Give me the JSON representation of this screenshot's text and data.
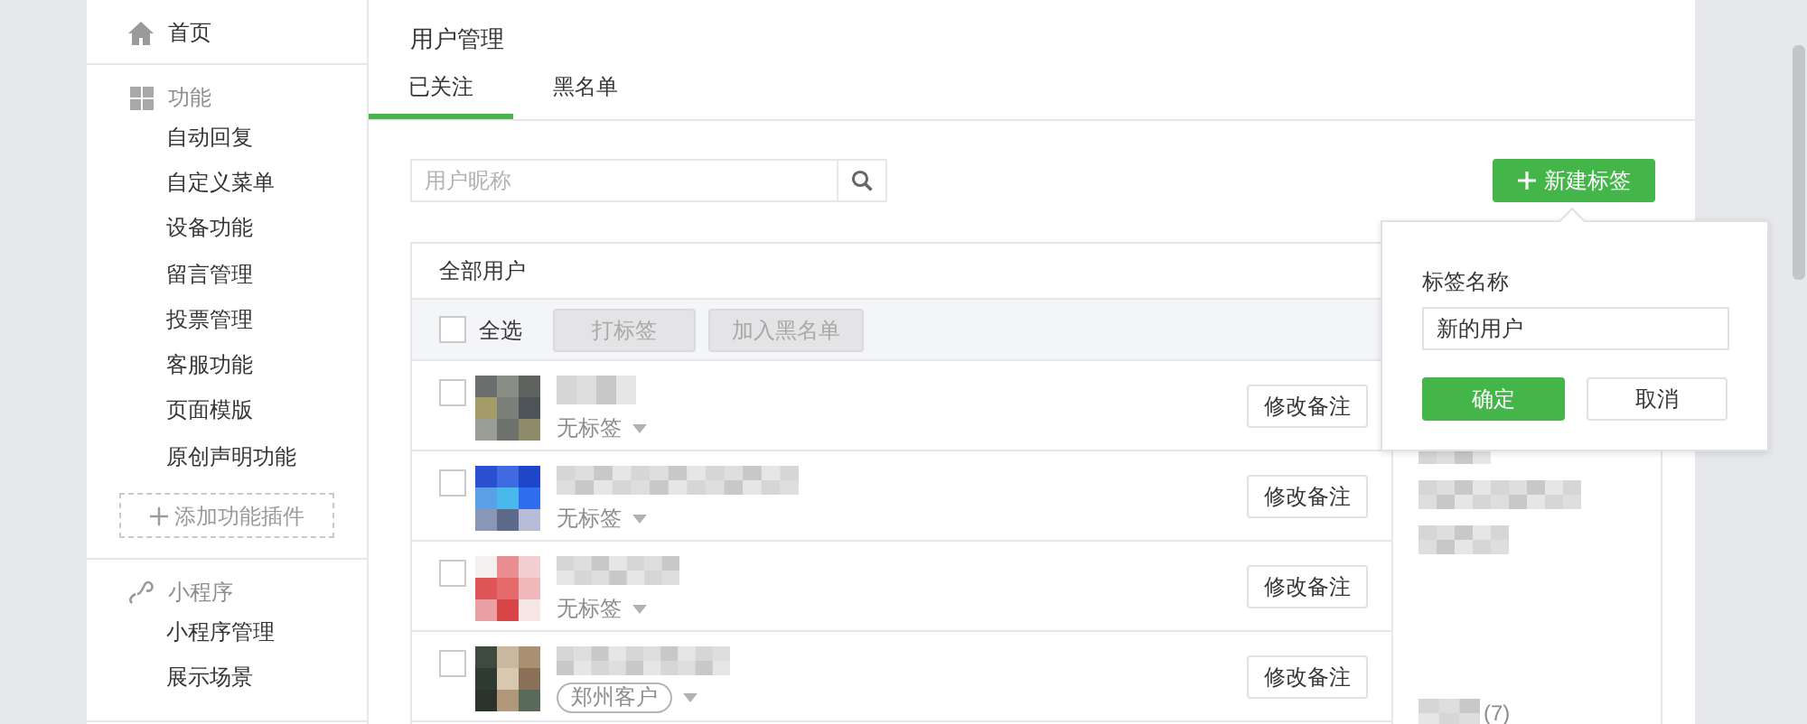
{
  "sidebar": {
    "items": [
      {
        "label": "首页"
      },
      {
        "label": "功能",
        "children": [
          {
            "label": "自动回复"
          },
          {
            "label": "自定义菜单"
          },
          {
            "label": "设备功能"
          },
          {
            "label": "留言管理"
          },
          {
            "label": "投票管理"
          },
          {
            "label": "客服功能"
          },
          {
            "label": "页面模版"
          },
          {
            "label": "原创声明功能"
          }
        ],
        "add_button": "添加功能插件"
      },
      {
        "label": "小程序",
        "children": [
          {
            "label": "小程序管理"
          },
          {
            "label": "展示场景"
          }
        ]
      }
    ]
  },
  "page_title": "用户管理",
  "tabs": [
    {
      "label": "已关注",
      "selected": true
    },
    {
      "label": "黑名单",
      "selected": false
    }
  ],
  "search": {
    "placeholder": "用户昵称"
  },
  "new_tag_button": "新建标签",
  "table": {
    "title": "全部用户",
    "select_all": {
      "label": "全选",
      "checked": false
    },
    "actions": [
      "打标签",
      "加入黑名单"
    ],
    "rows": [
      {
        "checked": false,
        "kind": "plain",
        "tag": "无标签",
        "remark_button": "修改备注"
      },
      {
        "checked": false,
        "kind": "plain",
        "tag": "无标签",
        "remark_button": "修改备注"
      },
      {
        "checked": false,
        "kind": "plain",
        "tag": "无标签",
        "remark_button": "修改备注"
      },
      {
        "checked": false,
        "kind": "chip",
        "tag": "郑州客户",
        "remark_button": "修改备注"
      }
    ]
  },
  "tag_list": [
    {
      "kind": "blurred"
    },
    {
      "kind": "blurred"
    },
    {
      "kind": "blurred"
    },
    {
      "kind": "counted",
      "count": "(7)"
    }
  ],
  "popover": {
    "label": "标签名称",
    "value": "新的用户",
    "confirm": "确定",
    "cancel": "取消"
  }
}
